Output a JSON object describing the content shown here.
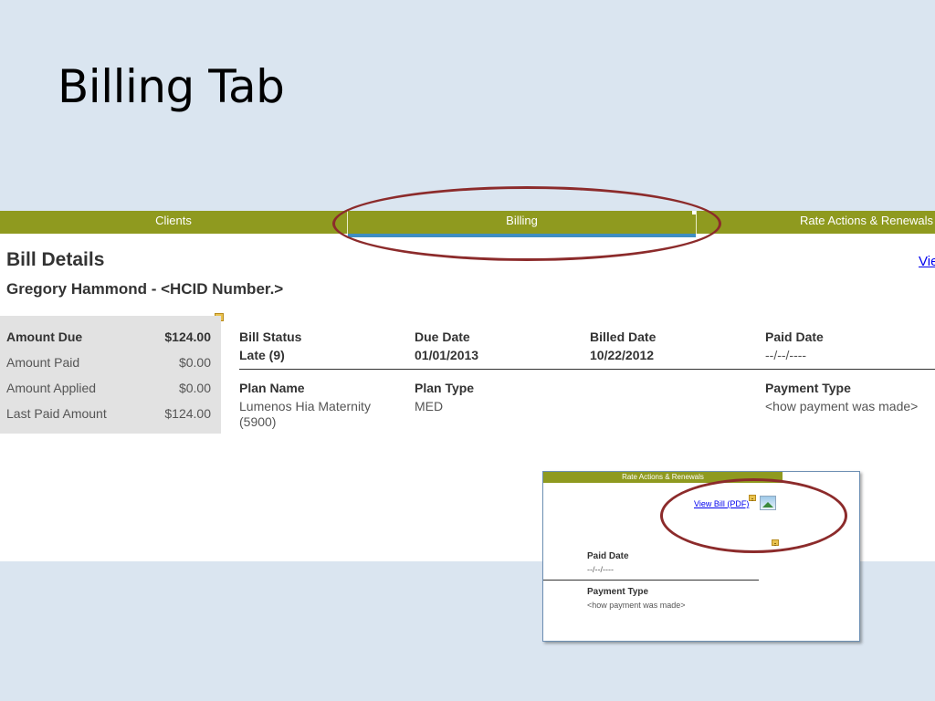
{
  "slide": {
    "title": "Billing Tab"
  },
  "tabs": [
    {
      "label": "Clients"
    },
    {
      "label": "Billing"
    },
    {
      "label": "Rate Actions & Renewals"
    }
  ],
  "header": {
    "title": "Bill Details",
    "client_name": "Gregory Hammond - <HCID Number.>",
    "view_link": "Vie"
  },
  "summary": [
    {
      "label": "Amount Due",
      "value": "$124.00"
    },
    {
      "label": "Amount Paid",
      "value": "$0.00"
    },
    {
      "label": "Amount Applied",
      "value": "$0.00"
    },
    {
      "label": "Last Paid Amount",
      "value": "$124.00"
    }
  ],
  "details": {
    "bill_status": {
      "label": "Bill Status",
      "value": "Late (9)"
    },
    "due_date": {
      "label": "Due Date",
      "value": "01/01/2013"
    },
    "billed_date": {
      "label": "Billed Date",
      "value": "10/22/2012"
    },
    "paid_date": {
      "label": "Paid Date",
      "value": "--/--/----"
    },
    "plan_name": {
      "label": "Plan Name",
      "value_line1": "Lumenos Hia Maternity",
      "value_line2": "(5900)"
    },
    "plan_type": {
      "label": "Plan Type",
      "value": "MED"
    },
    "payment_type": {
      "label": "Payment Type",
      "value": "<how payment was made>"
    }
  },
  "inset": {
    "tab_label": "Rate Actions & Renewals",
    "view_bill_link": "View Bill (PDF)",
    "paid_date": {
      "label": "Paid Date",
      "value": "--/--/----"
    },
    "payment_type": {
      "label": "Payment Type",
      "value": "<how payment was made>"
    }
  },
  "colors": {
    "tab_bar": "#8f9a1f",
    "active_tab_underline": "#3f8ec2",
    "highlight_ellipse": "#8c2b2b",
    "slide_background": "#dae5f0"
  }
}
